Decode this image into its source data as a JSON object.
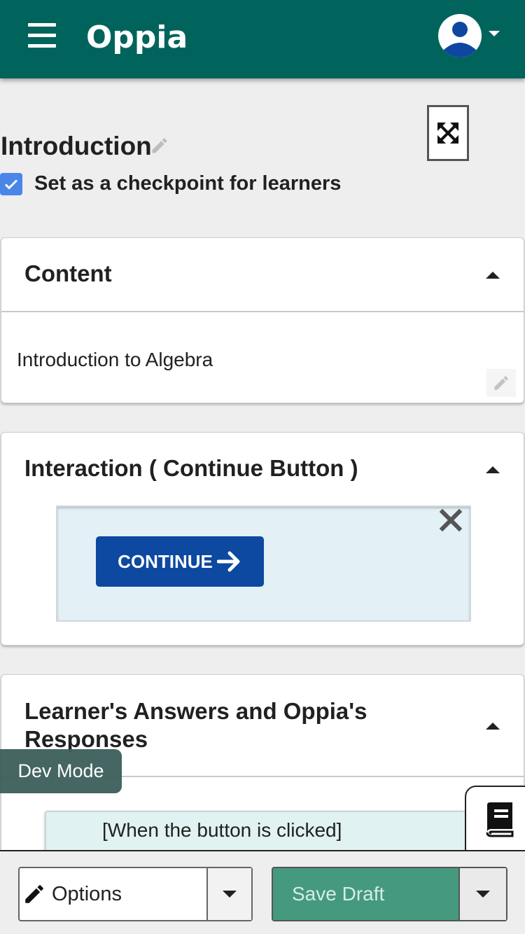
{
  "header": {
    "brand": "Oppia",
    "menu_icon": "hamburger-menu-icon",
    "avatar_icon": "user-avatar-icon",
    "bg_color": "#00645c"
  },
  "state": {
    "title": "Introduction",
    "checkpoint_label": "Set as a checkpoint for learners",
    "checkpoint_checked": true
  },
  "content_card": {
    "title": "Content",
    "text": "Introduction to Algebra"
  },
  "interaction_card": {
    "title": "Interaction ( Continue Button )",
    "button_label": "CONTINUE",
    "button_color": "#0d48a1"
  },
  "answers_card": {
    "title": "Learner's Answers and Oppia's Responses",
    "rule_text": "[When the button is clicked]"
  },
  "dev_mode_label": "Dev Mode",
  "footer": {
    "options_label": "Options",
    "save_label": "Save Draft",
    "save_color": "#45997f"
  }
}
